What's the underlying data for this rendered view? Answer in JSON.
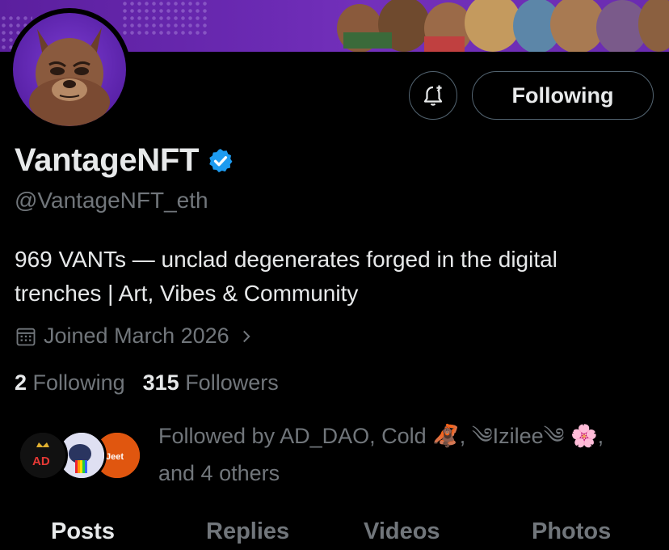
{
  "profile": {
    "display_name": "VantageNFT",
    "handle": "@VantageNFT_eth",
    "bio_line1": "969 VANTs — unclad degenerates forged in the digital",
    "bio_line2": "trenches | Art, Vibes & Community",
    "joined": "Joined March 2026",
    "following_count": "2",
    "following_label": "Following",
    "followers_count": "315",
    "followers_label": "Followers"
  },
  "actions": {
    "follow_label": "Following",
    "notify_icon": "bell-plus-icon"
  },
  "followed_by": {
    "prefix": "Followed by AD_DAO, Cold",
    "emoji1": "🦧",
    "mid": ", ",
    "name2": "༄ᶦᶻˡᵉᵉ༄Izilee༄ᶦ",
    "name2_display": "༄Izilee༄",
    "emoji2": "🌸",
    "suffix": ",",
    "line2": "and 4 others",
    "avatar1_text": "AD",
    "avatar3_text": "Jeet"
  },
  "tabs": [
    {
      "label": "Posts",
      "active": true
    },
    {
      "label": "Replies",
      "active": false
    },
    {
      "label": "Videos",
      "active": false
    },
    {
      "label": "Photos",
      "active": false
    }
  ],
  "colors": {
    "accent": "#1d9bf0",
    "banner": "#6b2ab3",
    "muted": "#71767b",
    "text": "#e7e9ea"
  }
}
